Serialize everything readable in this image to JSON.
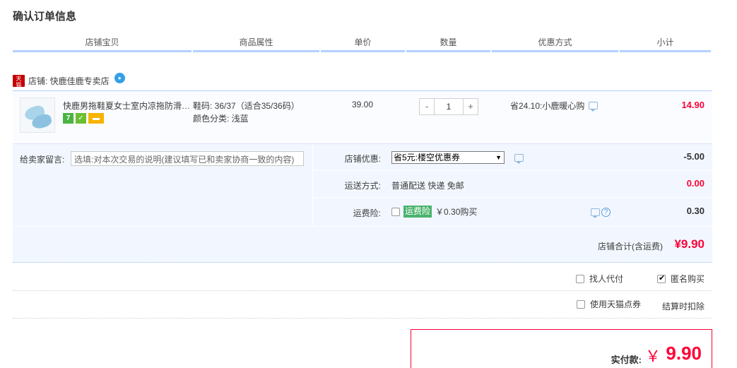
{
  "page": {
    "title": "确认订单信息"
  },
  "table_headers": [
    "店铺宝贝",
    "商品属性",
    "单价",
    "数量",
    "优惠方式",
    "小计"
  ],
  "shop": {
    "label": "店铺: 快鹿佳鹿专卖店"
  },
  "item": {
    "title": "快鹿男拖鞋夏女士室内凉拖防滑浴室家居拖鞋",
    "badges": [
      "7",
      "shield",
      "card"
    ],
    "attr_size": "鞋码: 36/37（适合35/36码）",
    "attr_color": "颜色分类: 浅蓝",
    "unit_price": "39.00",
    "quantity": {
      "minus": "-",
      "value": "1",
      "plus": "+"
    },
    "discount": "省24.10:小鹿暖心购",
    "subtotal": "14.90"
  },
  "memo": {
    "label": "给卖家留言:",
    "placeholder": "选填:对本次交易的说明(建议填写已和卖家协商一致的内容)"
  },
  "shop_coupon": {
    "label": "店铺优惠:",
    "selected": "省5元:楼空优惠券",
    "amount": "-5.00"
  },
  "shipping": {
    "label": "运送方式:",
    "value": "普通配送 快递 免邮",
    "amount": "0.00"
  },
  "insurance": {
    "label": "运费险:",
    "tag": "运费险",
    "price": "￥0.30购买",
    "amount": "0.30"
  },
  "shop_total": {
    "label": "店铺合计(含运费)",
    "value": "¥9.90"
  },
  "options": {
    "proxy_pay": "找人代付",
    "anonymous": "匿名购买",
    "tmall_points": "使用天猫点券",
    "points_note": "结算时扣除"
  },
  "payment": {
    "label": "实付款:",
    "currency": "￥",
    "value": "9.90"
  },
  "colors": {
    "accent_red": "#ff0036",
    "header_line": "#b2d1ff",
    "panel_bg": "#f2f7ff"
  }
}
